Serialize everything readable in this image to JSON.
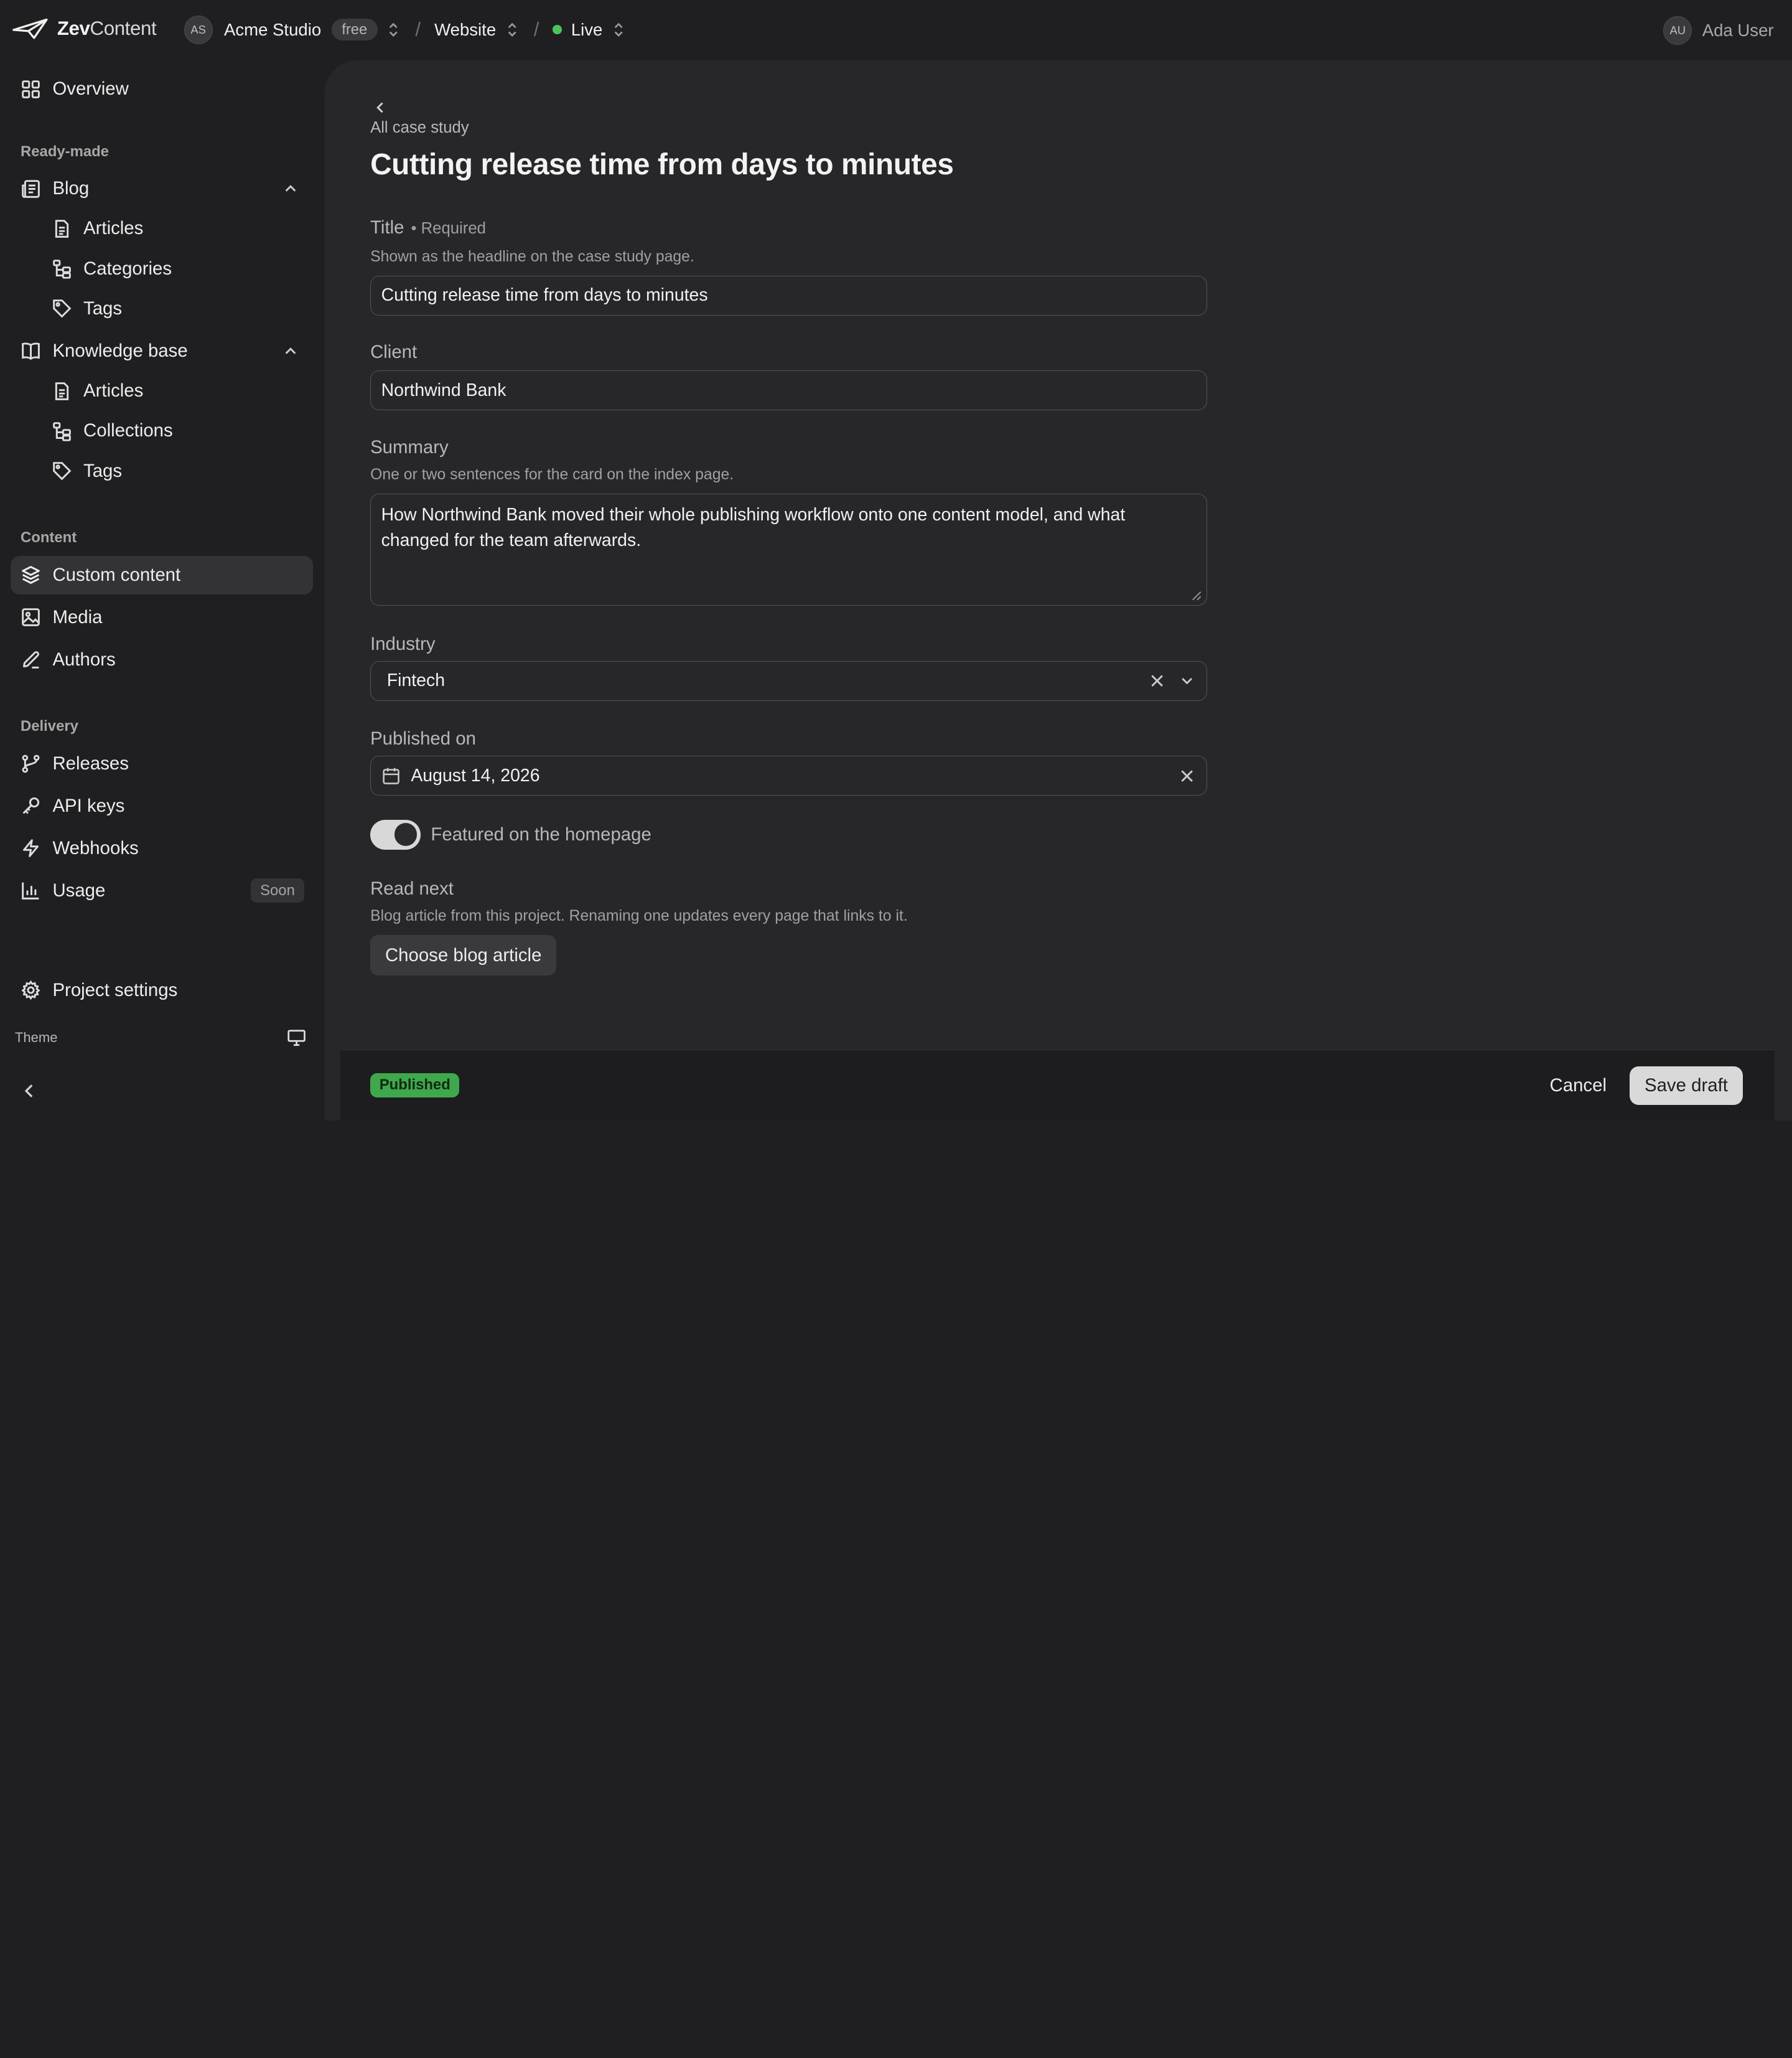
{
  "topbar": {
    "logo_bold": "Zev",
    "logo_light": "Content",
    "org_initials": "AS",
    "org_name": "Acme Studio",
    "plan": "free",
    "separator": "/",
    "site": "Website",
    "environment": "Live",
    "user_initials": "AU",
    "user_name": "Ada User"
  },
  "sidebar": {
    "overview": "Overview",
    "sections": {
      "ready_made": "Ready-made",
      "content": "Content",
      "delivery": "Delivery"
    },
    "blog": {
      "label": "Blog",
      "items": [
        "Articles",
        "Categories",
        "Tags"
      ]
    },
    "knowledge_base": {
      "label": "Knowledge base",
      "items": [
        "Articles",
        "Collections",
        "Tags"
      ]
    },
    "content_items": [
      "Custom content",
      "Media",
      "Authors"
    ],
    "delivery_items": [
      "Releases",
      "API keys",
      "Webhooks",
      "Usage"
    ],
    "soon_badge": "Soon",
    "project_settings": "Project settings",
    "theme_label": "Theme"
  },
  "page": {
    "parent": "All case study",
    "title": "Cutting release time from days to minutes"
  },
  "form": {
    "title": {
      "label": "Title",
      "required": "• Required",
      "help": "Shown as the headline on the case study page.",
      "value": "Cutting release time from days to minutes"
    },
    "client": {
      "label": "Client",
      "value": "Northwind Bank"
    },
    "summary": {
      "label": "Summary",
      "help": "One or two sentences for the card on the index page.",
      "value": "How Northwind Bank moved their whole publishing workflow onto one content model, and what changed for the team afterwards."
    },
    "industry": {
      "label": "Industry",
      "value": "Fintech"
    },
    "published_on": {
      "label": "Published on",
      "value": "August 14, 2026"
    },
    "featured": {
      "label": "Featured on the homepage",
      "on": true
    },
    "read_next": {
      "label": "Read next",
      "help": "Blog article from this project. Renaming one updates every page that links to it.",
      "button": "Choose blog article"
    }
  },
  "footer": {
    "status": "Published",
    "cancel": "Cancel",
    "save": "Save draft"
  },
  "colors": {
    "background": "#1f1f21",
    "panel": "#27272a",
    "live": "#4cc45c",
    "published": "#3fa84d"
  }
}
